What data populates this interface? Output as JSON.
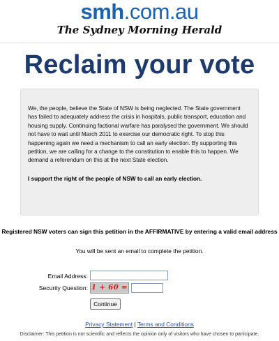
{
  "masthead": {
    "domain_bold": "smh",
    "domain_rest": ".com.au",
    "paper_name": "The Sydney Morning Herald"
  },
  "headline": "Reclaim your vote",
  "petition": {
    "body": "We, the people, believe the State of NSW is being neglected. The State government has failed to adequately address the crisis in hospitals, public transport, education and housing supply. Continuing factional warfare has paralysed the government. We should not have to wait until March 2011 to exercise our democratic right. To stop this happening again we need a mechanism to call an early election. By supporting this petition, we are calling for a change to the constitution to enable this to happen. We demand a referendum on this at the next State election.",
    "support_statement": "I support the right of the people of NSW to call an early election."
  },
  "instructions": {
    "registered_voters": "Registered NSW voters can sign this petition in the AFFIRMATIVE by entering a valid email address",
    "email_note": "You will be sent an email to complete the petition."
  },
  "form": {
    "email_label": "Email Address:",
    "email_value": "",
    "security_label": "Security Question:",
    "captcha_text": "1 + 60 =",
    "answer_value": "",
    "continue_label": "Continue"
  },
  "footer": {
    "privacy_label": "Privacy Statement",
    "separator": "|",
    "terms_label": "Terms and Conditions",
    "disclaimer": "Disclaimer: This petition is not scientific and reflects the opinion only of visitors who have chosen to participate."
  }
}
